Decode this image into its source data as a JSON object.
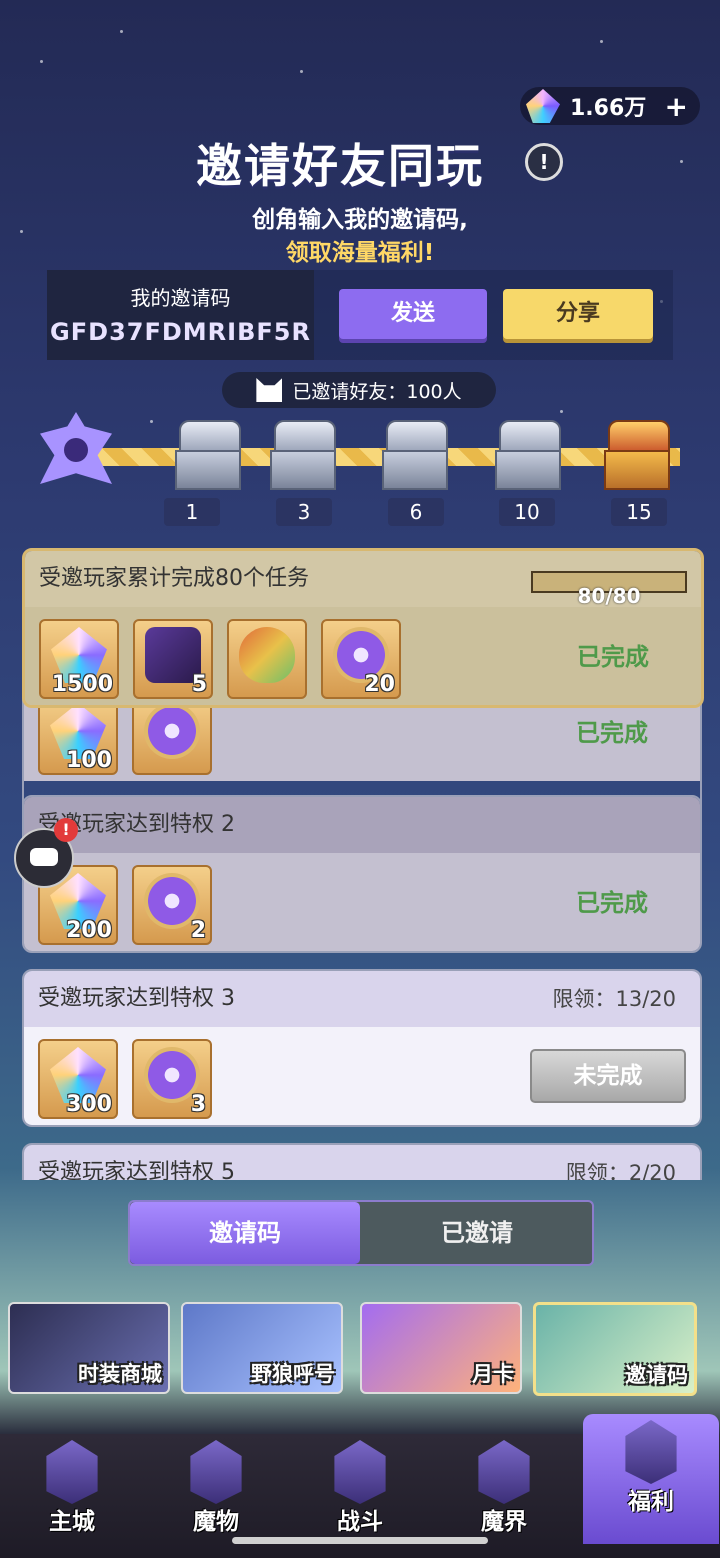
{
  "currency": {
    "value": "1.66万",
    "plus": "+",
    "icon": "star-gem-icon"
  },
  "header": {
    "title": "邀请好友同玩",
    "info_icon": "!",
    "subtitle1": "创角输入我的邀请码,",
    "subtitle2": "领取海量福利!"
  },
  "invite": {
    "label": "我的邀请码",
    "code": "GFD37FDMRIBF5R",
    "send": "发送",
    "share": "分享"
  },
  "invited": {
    "text": "已邀请好友：100人"
  },
  "milestones": [
    "1",
    "3",
    "6",
    "10",
    "15"
  ],
  "tasks": [
    {
      "title": "受邀玩家累计完成80个任务",
      "progress": "80/80",
      "progress_fraction": 1.0,
      "status": "已完成",
      "items": [
        {
          "icon": "star-gem-icon",
          "count": "1500"
        },
        {
          "icon": "scroll-icon",
          "count": "5"
        },
        {
          "icon": "egg-icon",
          "count": ""
        },
        {
          "icon": "medal-icon",
          "count": "20"
        }
      ]
    },
    {
      "title": "",
      "status": "已完成",
      "items": [
        {
          "icon": "star-gem-icon",
          "count": "100"
        },
        {
          "icon": "medal-icon",
          "count": ""
        }
      ]
    },
    {
      "title": "受邀玩家达到特权 2",
      "status": "已完成",
      "items": [
        {
          "icon": "star-gem-icon",
          "count": "200"
        },
        {
          "icon": "medal-icon",
          "count": "2"
        }
      ]
    },
    {
      "title": "受邀玩家达到特权 3",
      "limit": "限领：13/20",
      "status": "未完成",
      "items": [
        {
          "icon": "star-gem-icon",
          "count": "300"
        },
        {
          "icon": "medal-icon",
          "count": "3"
        }
      ]
    },
    {
      "title": "受邀玩家达到特权 5",
      "limit": "限领：2/20"
    }
  ],
  "switch": {
    "active": "邀请码",
    "inactive": "已邀请"
  },
  "shop": [
    "时装商城",
    "野狼呼号",
    "月卡",
    "邀请码"
  ],
  "nav": [
    "主城",
    "魔物",
    "战斗",
    "魔界",
    "福利"
  ],
  "colors": {
    "accent": "#8d6cf0",
    "share": "#f7d86a",
    "done": "#4f9a4a"
  }
}
